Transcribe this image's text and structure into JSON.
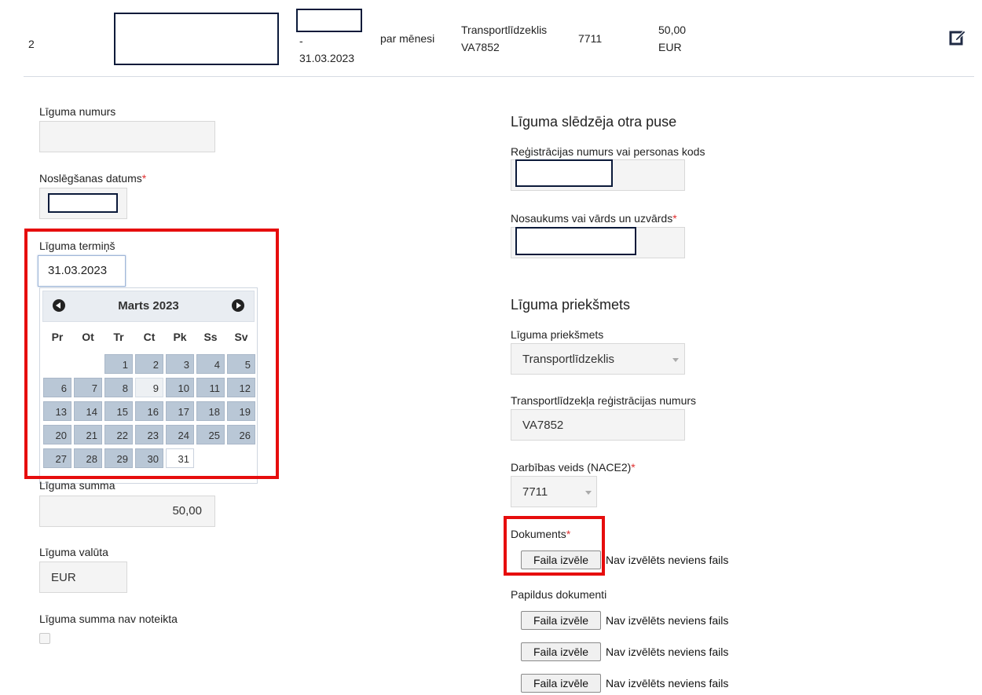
{
  "row": {
    "index": "2",
    "date_dash": "-",
    "end_date": "31.03.2023",
    "period": "par mēnesi",
    "subject_line1": "Transportlīdzeklis",
    "subject_line2": "VA7852",
    "nace": "7711",
    "amount_line1": "50,00",
    "amount_line2": "EUR"
  },
  "left": {
    "contract_number_label": "Līguma numurs",
    "conclusion_date_label": "Noslēgšanas datums",
    "term_label": "Līguma termiņš",
    "term_value": "31.03.2023",
    "sum_label": "Līguma summa",
    "sum_value": "50,00",
    "currency_label": "Līguma valūta",
    "currency_value": "EUR",
    "sum_undetermined_label": "Līguma summa nav noteikta"
  },
  "calendar": {
    "title": "Marts 2023",
    "weekdays": [
      "Pr",
      "Ot",
      "Tr",
      "Ct",
      "Pk",
      "Ss",
      "Sv"
    ],
    "days": [
      "1",
      "2",
      "3",
      "4",
      "5",
      "6",
      "7",
      "8",
      "9",
      "10",
      "11",
      "12",
      "13",
      "14",
      "15",
      "16",
      "17",
      "18",
      "19",
      "20",
      "21",
      "22",
      "23",
      "24",
      "25",
      "26",
      "27",
      "28",
      "29",
      "30",
      "31"
    ],
    "first_weekday_index": 2,
    "today_day": 9,
    "selected_day": 31
  },
  "right": {
    "other_party_title": "Līguma slēdzēja otra puse",
    "reg_number_label": "Reģistrācijas numurs vai personas kods",
    "name_label": "Nosaukums vai vārds un uzvārds",
    "subject_title": "Līguma priekšmets",
    "subject_label": "Līguma priekšmets",
    "subject_value": "Transportlīdzeklis",
    "vehicle_reg_label": "Transportlīdzekļa reģistrācijas numurs",
    "vehicle_reg_value": "VA7852",
    "nace_label": "Darbības veids (NACE2)",
    "nace_value": "7711",
    "document_label": "Dokuments",
    "file_button": "Faila izvēle",
    "no_file": "Nav izvēlēts neviens fails",
    "additional_docs_label": "Papildus dokumenti"
  },
  "required_mark": "*"
}
